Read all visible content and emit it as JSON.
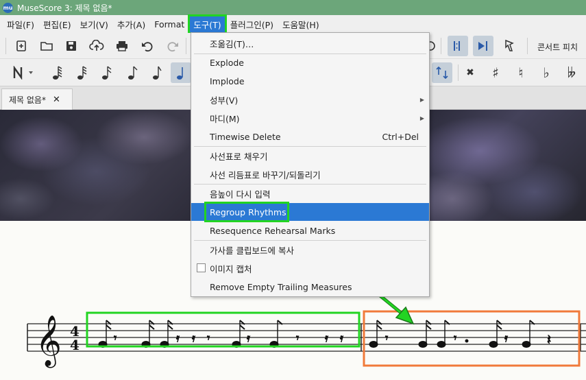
{
  "window": {
    "title": "MuseScore 3: 제목 없음*",
    "icon": "mu"
  },
  "menubar": [
    {
      "label": "파일(F)"
    },
    {
      "label": "편집(E)"
    },
    {
      "label": "보기(V)"
    },
    {
      "label": "추가(A)"
    },
    {
      "label": "Format"
    },
    {
      "label": "도구(T)"
    },
    {
      "label": "플러그인(P)"
    },
    {
      "label": "도움말(H)"
    }
  ],
  "toolbar": {
    "concert_pitch": "콘서트 피치"
  },
  "tab": {
    "label": "제목 없음*",
    "close": "✕"
  },
  "tools_menu": {
    "items": [
      {
        "label": "조옮김(T)…"
      },
      {
        "label": "Explode"
      },
      {
        "label": "Implode"
      },
      {
        "label": "성부(V)"
      },
      {
        "label": "마디(M)"
      },
      {
        "label": "Timewise Delete",
        "shortcut": "Ctrl+Del"
      },
      {
        "label": "사선표로 채우기"
      },
      {
        "label": "사선 리듬표로 바꾸기/되돌리기"
      },
      {
        "label": "음높이 다시 입력"
      },
      {
        "label": "Regroup Rhythms"
      },
      {
        "label": "Resequence Rehearsal Marks"
      },
      {
        "label": "가사를 클립보드에 복사"
      },
      {
        "label": "이미지 캡처"
      },
      {
        "label": "Remove Empty Trailing Measures"
      }
    ]
  },
  "score": {
    "time_signature_top": "4",
    "time_signature_bottom": "4"
  },
  "colors": {
    "highlight_green": "#22d422",
    "highlight_orange": "#f07a3a",
    "menu_select": "#2b79d4",
    "titlebar": "#6ca67a"
  }
}
